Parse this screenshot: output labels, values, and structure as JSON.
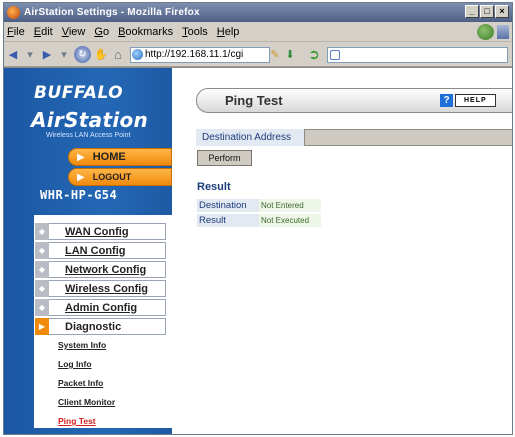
{
  "window": {
    "title": "AirStation Settings - Mozilla Firefox",
    "controls": [
      "_",
      "□",
      "×"
    ]
  },
  "menubar": {
    "items": [
      {
        "u": "F",
        "rest": "ile"
      },
      {
        "u": "E",
        "rest": "dit"
      },
      {
        "u": "V",
        "rest": "iew"
      },
      {
        "u": "G",
        "rest": "o"
      },
      {
        "u": "B",
        "rest": "ookmarks"
      },
      {
        "u": "T",
        "rest": "ools"
      },
      {
        "u": "H",
        "rest": "elp"
      }
    ]
  },
  "navbar": {
    "url": "http://192.168.11.1/cgi"
  },
  "sidebar": {
    "brand": "BUFFALO",
    "product": "AirStation",
    "tagline": "Wireless LAN Access Point",
    "home_label": "HOME",
    "logout_label": "LOGOUT",
    "model": "WHR-HP-G54",
    "configs": [
      "WAN Config",
      "LAN Config",
      "Network Config",
      "Wireless Config",
      "Admin Config",
      "Diagnostic"
    ],
    "sublinks": [
      "System Info",
      "Log Info",
      "Packet Info",
      "Client Monitor",
      "Ping Test"
    ]
  },
  "content": {
    "title": "Ping Test",
    "help_q": "?",
    "help_label": "HELP",
    "dest_label": "Destination Address",
    "dest_value": "",
    "perform_label": "Perform",
    "result_heading": "Result",
    "results": [
      {
        "key": "Destination",
        "value": "Not Entered"
      },
      {
        "key": "Result",
        "value": "Not Executed"
      }
    ]
  },
  "colors": {
    "sidebar_blue": "#2468b5",
    "accent_orange": "#f08a0c",
    "current_link_red": "#d32020"
  }
}
